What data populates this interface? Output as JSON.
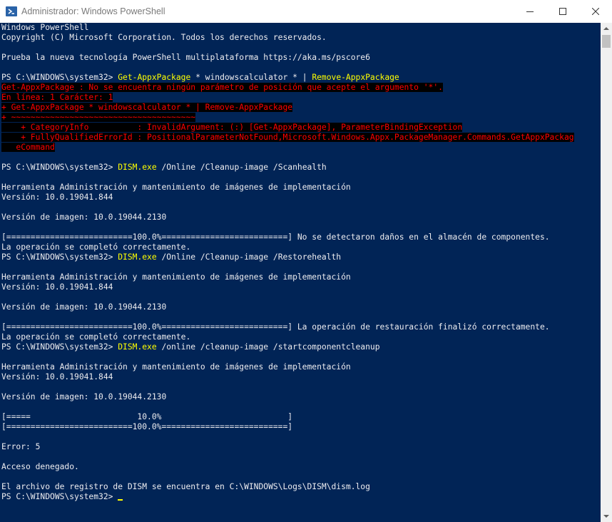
{
  "window": {
    "title": "Administrador: Windows PowerShell"
  },
  "colors": {
    "background": "#012456",
    "foreground": "#eeedf0",
    "error_fg": "#ff0000",
    "error_bg": "#000000",
    "command": "#ffff00",
    "params": "#eeedf0"
  },
  "console": {
    "l01": "Windows PowerShell",
    "l02": "Copyright (C) Microsoft Corporation. Todos los derechos reservados.",
    "l04": "Prueba la nueva tecnología PowerShell multiplataforma https://aka.ms/pscore6",
    "l06_prompt": "PS C:\\WINDOWS\\system32> ",
    "l06_cmd": "Get-AppxPackage",
    "l06_args": " * windowscalculator * | ",
    "l06_cmd2": "Remove-AppxPackage",
    "l07": "Get-AppxPackage : No se encuentra ningún parámetro de posición que acepte el argumento '*'.",
    "l08": "En línea: 1 Carácter: 1",
    "l09": "+ Get-AppxPackage * windowscalculator * | Remove-AppxPackage",
    "l10": "+ ~~~~~~~~~~~~~~~~~~~~~~~~~~~~~~~~~~~~~~",
    "l11": "    + CategoryInfo          : InvalidArgument: (:) [Get-AppxPackage], ParameterBindingException",
    "l12": "    + FullyQualifiedErrorId : PositionalParameterNotFound,Microsoft.Windows.Appx.PackageManager.Commands.GetAppxPackag",
    "l13": "   eCommand",
    "l15_prompt": "PS C:\\WINDOWS\\system32> ",
    "l15_cmd": "DISM.exe",
    "l15_args": " /Online /Cleanup-image /Scanhealth",
    "l17": "Herramienta Administración y mantenimiento de imágenes de implementación",
    "l18": "Versión: 10.0.19041.844",
    "l20": "Versión de imagen: 10.0.19044.2130",
    "l22": "[==========================100.0%==========================] No se detectaron daños en el almacén de componentes.",
    "l23": "La operación se completó correctamente.",
    "l24_prompt": "PS C:\\WINDOWS\\system32> ",
    "l24_cmd": "DISM.exe",
    "l24_args": " /Online /Cleanup-image /Restorehealth",
    "l26": "Herramienta Administración y mantenimiento de imágenes de implementación",
    "l27": "Versión: 10.0.19041.844",
    "l29": "Versión de imagen: 10.0.19044.2130",
    "l31": "[==========================100.0%==========================] La operación de restauración finalizó correctamente.",
    "l32": "La operación se completó correctamente.",
    "l33_prompt": "PS C:\\WINDOWS\\system32> ",
    "l33_cmd": "DISM.exe",
    "l33_args": " /online /cleanup-image /startcomponentcleanup",
    "l35": "Herramienta Administración y mantenimiento de imágenes de implementación",
    "l36": "Versión: 10.0.19041.844",
    "l38": "Versión de imagen: 10.0.19044.2130",
    "l40": "[=====                      10.0%                          ]",
    "l41": "[==========================100.0%==========================]",
    "l43": "Error: 5",
    "l45": "Acceso denegado.",
    "l47": "El archivo de registro de DISM se encuentra en C:\\WINDOWS\\Logs\\DISM\\dism.log",
    "l48_prompt": "PS C:\\WINDOWS\\system32> "
  }
}
